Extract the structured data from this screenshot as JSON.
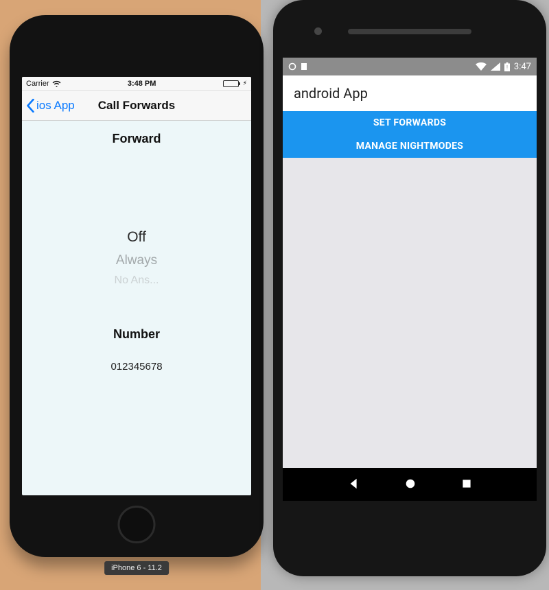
{
  "iphone": {
    "device_label": "iPhone 6 - 11.2",
    "status": {
      "carrier": "Carrier",
      "time": "3:48 PM"
    },
    "nav": {
      "back_label": "ios App",
      "title": "Call Forwards"
    },
    "forward": {
      "heading": "Forward",
      "options": [
        "Off",
        "Always",
        "No Ans..."
      ],
      "selected_index": 0
    },
    "number": {
      "heading": "Number",
      "value": "012345678"
    }
  },
  "android": {
    "status": {
      "time": "3:47"
    },
    "appbar": {
      "title": "android App"
    },
    "menu": {
      "item1": "SET FORWARDS",
      "item2": "MANAGE NIGHTMODES"
    }
  }
}
